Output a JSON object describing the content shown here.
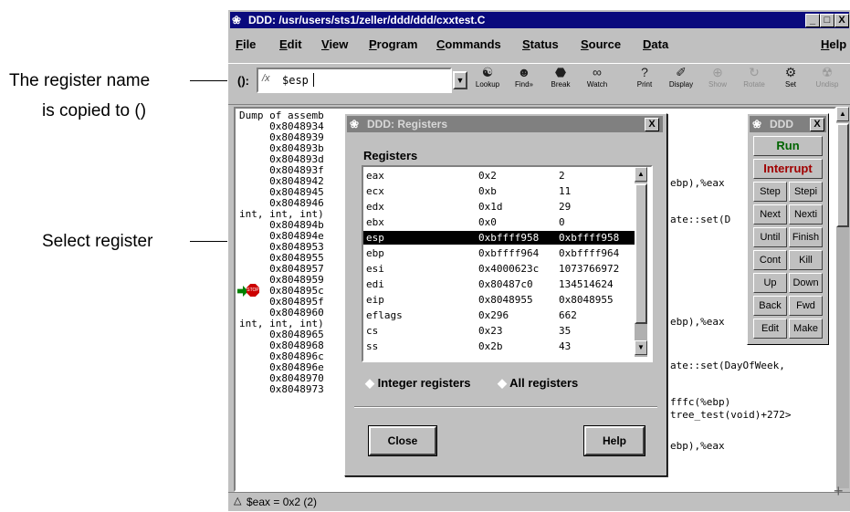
{
  "annotations": {
    "register_name_line1": "The register name",
    "register_name_line2": "is copied to ()",
    "select_register": "Select register"
  },
  "main_window": {
    "title": "DDD: /usr/users/sts1/zeller/ddd/ddd/cxxtest.C",
    "controls": [
      "_",
      "□",
      "X"
    ],
    "menu": [
      "File",
      "Edit",
      "View",
      "Program",
      "Commands",
      "Status",
      "Source",
      "Data",
      "Help"
    ],
    "arg_label": "():",
    "arg_value": "$esp",
    "toolbar": [
      "Lookup",
      "Find»",
      "Break",
      "Watch",
      "Print",
      "Display",
      "Show",
      "Rotate",
      "Set",
      "Undisp"
    ],
    "status_text": "$eax = 0x2 (2)"
  },
  "assembly": {
    "header": "Dump of assemb",
    "lines": [
      "     0x8048934",
      "     0x8048939",
      "     0x804893b",
      "     0x804893d",
      "     0x804893f",
      "     0x8048942",
      "     0x8048945",
      "     0x8048946",
      "int, int, int)",
      "     0x804894b",
      "     0x804894e",
      "     0x8048953",
      "     0x8048955",
      "     0x8048957",
      "     0x8048959",
      "     0x804895c",
      "     0x804895f",
      "     0x8048960",
      "int, int, int)",
      "     0x8048965",
      "     0x8048968",
      "     0x804896c",
      "     0x804896e",
      "     0x8048970",
      "     0x8048973"
    ],
    "right_fragments": [
      "ebp),%eax",
      "ate::set(D",
      "ebp),%eax",
      "ate::set(DayOfWeek,",
      "fffc(%ebp)",
      "tree_test(void)+272>",
      "ebp),%eax"
    ]
  },
  "registers_dialog": {
    "title": "DDD: Registers",
    "close_x": "X",
    "heading": "Registers",
    "rows": [
      {
        "name": "eax",
        "hex": "0x2",
        "dec": "2"
      },
      {
        "name": "ecx",
        "hex": "0xb",
        "dec": "11"
      },
      {
        "name": "edx",
        "hex": "0x1d",
        "dec": "29"
      },
      {
        "name": "ebx",
        "hex": "0x0",
        "dec": "0"
      },
      {
        "name": "esp",
        "hex": "0xbffff958",
        "dec": "0xbffff958"
      },
      {
        "name": "ebp",
        "hex": "0xbffff964",
        "dec": "0xbffff964"
      },
      {
        "name": "esi",
        "hex": "0x4000623c",
        "dec": "1073766972"
      },
      {
        "name": "edi",
        "hex": "0x80487c0",
        "dec": "134514624"
      },
      {
        "name": "eip",
        "hex": "0x8048955",
        "dec": "0x8048955"
      },
      {
        "name": "eflags",
        "hex": "0x296",
        "dec": "662"
      },
      {
        "name": "cs",
        "hex": "0x23",
        "dec": "35"
      },
      {
        "name": "ss",
        "hex": "0x2b",
        "dec": "43"
      }
    ],
    "selected_row": "esp",
    "radio_integer": "Integer registers",
    "radio_all": "All registers",
    "close_button": "Close",
    "help_button": "Help"
  },
  "command_tool": {
    "title": "DDD",
    "close_x": "X",
    "run": "Run",
    "interrupt": "Interrupt",
    "buttons": [
      "Step",
      "Stepi",
      "Next",
      "Nexti",
      "Until",
      "Finish",
      "Cont",
      "Kill",
      "Up",
      "Down",
      "Back",
      "Fwd",
      "Edit",
      "Make"
    ]
  },
  "colors": {
    "title_active": "#0a0a7d",
    "title_inactive": "#808080",
    "run": "#006400",
    "interrupt": "#a00000",
    "stop_sign": "#cc0000",
    "exec_arrow": "#008000"
  }
}
